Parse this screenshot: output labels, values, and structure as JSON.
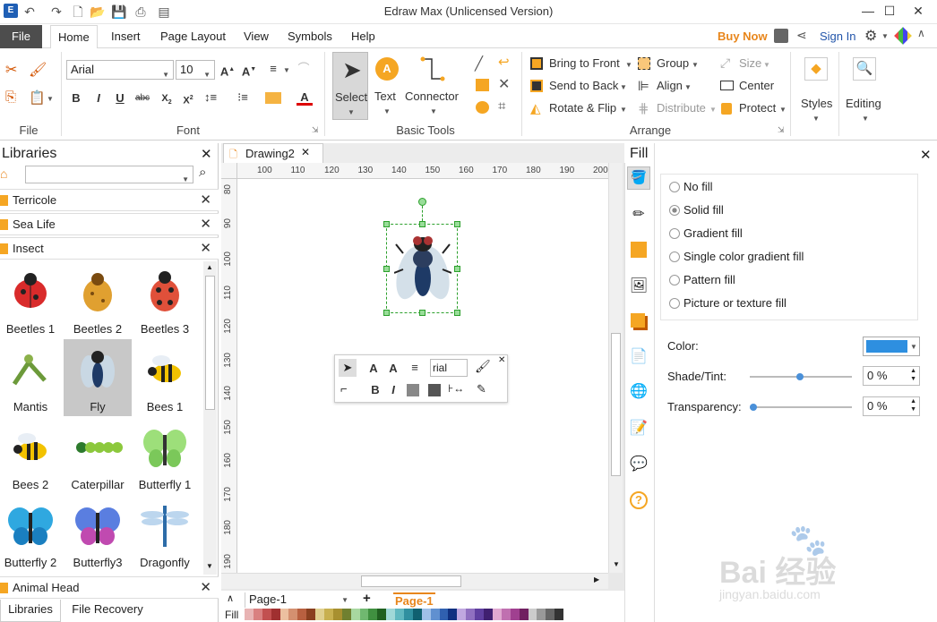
{
  "window": {
    "title": "Edraw Max (Unlicensed Version)"
  },
  "tabs": [
    "File",
    "Home",
    "Insert",
    "Page Layout",
    "View",
    "Symbols",
    "Help"
  ],
  "right_actions": {
    "buy_now": "Buy Now",
    "sign_in": "Sign In"
  },
  "ribbon": {
    "font_group": {
      "font_name": "Arial",
      "font_size": "10",
      "label": "Font"
    },
    "file_group": {
      "label": "File"
    },
    "basic_tools": {
      "select": "Select",
      "text": "Text",
      "connector": "Connector",
      "label": "Basic Tools"
    },
    "arrange": {
      "bring_to_front": "Bring to Front",
      "send_to_back": "Send to Back",
      "rotate_flip": "Rotate & Flip",
      "group": "Group",
      "align": "Align",
      "distribute": "Distribute",
      "size": "Size",
      "center": "Center",
      "protect": "Protect",
      "label": "Arrange"
    },
    "styles": "Styles",
    "editing": "Editing"
  },
  "libraries": {
    "title": "Libraries",
    "sections": [
      "Terricole",
      "Sea Life",
      "Insect",
      "Animal Head"
    ],
    "symbols": [
      {
        "name": "Beetles 1",
        "icon": "ladybug-red"
      },
      {
        "name": "Beetles 2",
        "icon": "beetle-orange"
      },
      {
        "name": "Beetles 3",
        "icon": "ladybug-dark"
      },
      {
        "name": "Mantis",
        "icon": "mantis"
      },
      {
        "name": "Fly",
        "icon": "fly"
      },
      {
        "name": "Bees 1",
        "icon": "bee"
      },
      {
        "name": "Bees 2",
        "icon": "bee"
      },
      {
        "name": "Caterpillar",
        "icon": "caterpillar"
      },
      {
        "name": "Butterfly 1",
        "icon": "butterfly-green"
      },
      {
        "name": "Butterfly 2",
        "icon": "butterfly-blue"
      },
      {
        "name": "Butterfly3",
        "icon": "butterfly-purple"
      },
      {
        "name": "Dragonfly",
        "icon": "dragonfly"
      }
    ],
    "selected_symbol": "Fly",
    "bottom_tabs": [
      "Libraries",
      "File Recovery"
    ]
  },
  "document": {
    "tab": "Drawing2",
    "ruler_top": [
      "100",
      "110",
      "120",
      "130",
      "140",
      "150",
      "160",
      "170",
      "180",
      "190",
      "200"
    ],
    "ruler_left": [
      "80",
      "90",
      "100",
      "110",
      "120",
      "130",
      "140",
      "150",
      "160",
      "170",
      "180",
      "190"
    ],
    "minitoolbar": {
      "font": "rial"
    },
    "page_select": "Page-1",
    "page_tab": "Page-1",
    "fill_label": "Fill"
  },
  "fill_panel": {
    "title": "Fill",
    "options": [
      "No fill",
      "Solid fill",
      "Gradient fill",
      "Single color gradient fill",
      "Pattern fill",
      "Picture or texture fill"
    ],
    "selected": "Solid fill",
    "color_label": "Color:",
    "color_value": "#2e8fe0",
    "shade_label": "Shade/Tint:",
    "shade_value": "0 %",
    "transparency_label": "Transparency:",
    "transparency_value": "0 %"
  },
  "watermark": {
    "text": "Bai 经验",
    "url": "jingyan.baidu.com"
  }
}
